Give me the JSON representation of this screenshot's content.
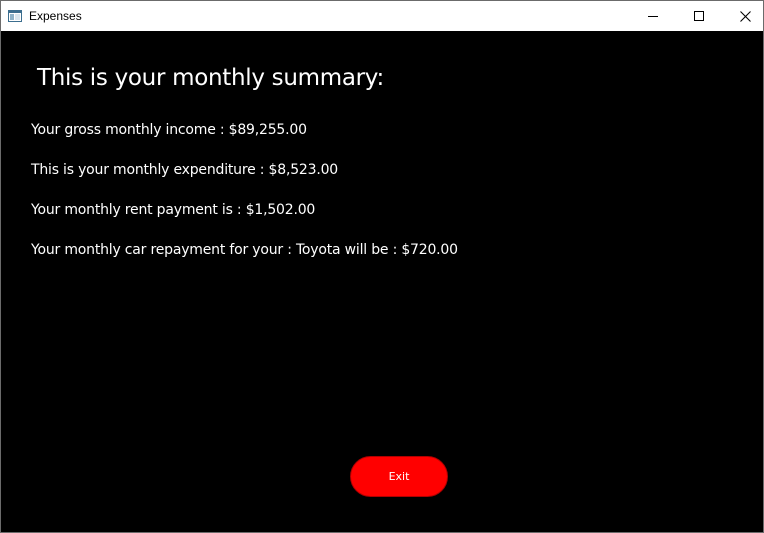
{
  "window": {
    "title": "Expenses",
    "icon": "window-app-icon",
    "controls": [
      "minimize-icon",
      "maximize-icon",
      "close-icon"
    ]
  },
  "summary": {
    "heading": "This is your monthly summary:",
    "lines": [
      "Your gross monthly income : $89,255.00",
      "This is your monthly expenditure : $8,523.00",
      "Your monthly rent payment is : $1,502.00",
      "Your monthly car repayment for your : Toyota will be : $720.00"
    ]
  },
  "actions": {
    "exit_label": "Exit"
  },
  "colors": {
    "background": "#000000",
    "text": "#ffffff",
    "exit_button": "#ff0000",
    "titlebar": "#ffffff"
  }
}
